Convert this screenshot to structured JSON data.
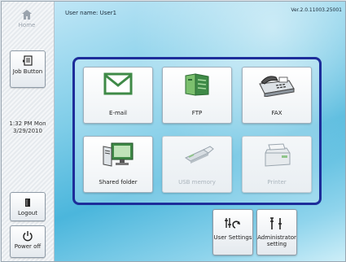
{
  "sidebar": {
    "home_label": "Home",
    "job_label": "Job Button",
    "clock_time": "1:32 PM  Mon",
    "clock_date": "3/29/2010",
    "logout_label": "Logout",
    "power_label": "Power off"
  },
  "header": {
    "username": "User name: User1",
    "version": "Ver.2.0.11003.25001"
  },
  "functions": [
    {
      "label": "E-mail",
      "icon": "envelope-icon",
      "enabled": true
    },
    {
      "label": "FTP",
      "icon": "ftp-server-icon",
      "enabled": true
    },
    {
      "label": "FAX",
      "icon": "fax-icon",
      "enabled": true
    },
    {
      "label": "Shared folder",
      "icon": "shared-folder-icon",
      "enabled": true
    },
    {
      "label": "USB memory",
      "icon": "usb-memory-icon",
      "enabled": false
    },
    {
      "label": "Printer",
      "icon": "printer-icon",
      "enabled": false
    }
  ],
  "bottom": {
    "user_settings_label": "User Settings",
    "admin_line1": "Administrator",
    "admin_line2": "setting"
  },
  "colors": {
    "panel_border": "#1d2d9a",
    "icon_green": "#3f8a47",
    "disabled_text": "#aab4bc"
  }
}
